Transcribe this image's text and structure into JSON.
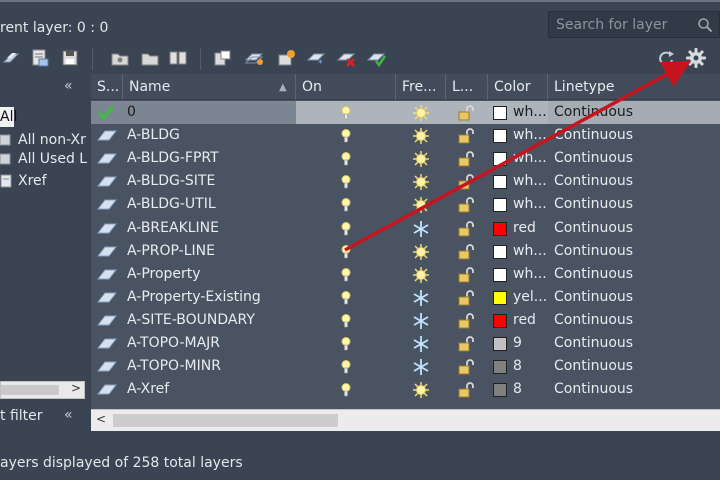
{
  "header": {
    "current_layer": "rent layer: 0 : 0"
  },
  "search": {
    "placeholder": "Search for layer"
  },
  "left_panel": {
    "collapse_glyph": "«",
    "items": [
      {
        "label": "All"
      },
      {
        "label": "All non-Xr"
      },
      {
        "label": "All Used L"
      },
      {
        "label": "Xref"
      }
    ],
    "filter_label": "t filter",
    "filter_collapse_glyph": "«"
  },
  "grid": {
    "columns": [
      {
        "key": "status",
        "label": "S..."
      },
      {
        "key": "name",
        "label": "Name"
      },
      {
        "key": "on",
        "label": "On"
      },
      {
        "key": "freeze",
        "label": "Fre..."
      },
      {
        "key": "lock",
        "label": "L..."
      },
      {
        "key": "color",
        "label": "Color"
      },
      {
        "key": "linetype",
        "label": "Linetype"
      }
    ],
    "rows": [
      {
        "name": "0",
        "current": true,
        "freeze": "sun",
        "color_name": "wh...",
        "color_hex": "#ffffff",
        "linetype": "Continuous"
      },
      {
        "name": "A-BLDG",
        "current": false,
        "freeze": "sun",
        "color_name": "wh...",
        "color_hex": "#ffffff",
        "linetype": "Continuous"
      },
      {
        "name": "A-BLDG-FPRT",
        "current": false,
        "freeze": "sun",
        "color_name": "wh...",
        "color_hex": "#ffffff",
        "linetype": "Continuous"
      },
      {
        "name": "A-BLDG-SITE",
        "current": false,
        "freeze": "sun",
        "color_name": "wh...",
        "color_hex": "#ffffff",
        "linetype": "Continuous"
      },
      {
        "name": "A-BLDG-UTIL",
        "current": false,
        "freeze": "sun",
        "color_name": "wh...",
        "color_hex": "#ffffff",
        "linetype": "Continuous"
      },
      {
        "name": "A-BREAKLINE",
        "current": false,
        "freeze": "snow",
        "color_name": "red",
        "color_hex": "#ff0000",
        "linetype": "Continuous"
      },
      {
        "name": "A-PROP-LINE",
        "current": false,
        "freeze": "sun",
        "color_name": "wh...",
        "color_hex": "#ffffff",
        "linetype": "Continuous"
      },
      {
        "name": "A-Property",
        "current": false,
        "freeze": "sun",
        "color_name": "wh...",
        "color_hex": "#ffffff",
        "linetype": "Continuous"
      },
      {
        "name": "A-Property-Existing",
        "current": false,
        "freeze": "snow",
        "color_name": "yel...",
        "color_hex": "#ffff00",
        "linetype": "Continuous"
      },
      {
        "name": "A-SITE-BOUNDARY",
        "current": false,
        "freeze": "snow",
        "color_name": "red",
        "color_hex": "#ff0000",
        "linetype": "Continuous"
      },
      {
        "name": "A-TOPO-MAJR",
        "current": false,
        "freeze": "snow",
        "color_name": "9",
        "color_hex": "#c0c0c0",
        "linetype": "Continuous"
      },
      {
        "name": "A-TOPO-MINR",
        "current": false,
        "freeze": "snow",
        "color_name": "8",
        "color_hex": "#808080",
        "linetype": "Continuous"
      },
      {
        "name": "A-Xref",
        "current": false,
        "freeze": "sun",
        "color_name": "8",
        "color_hex": "#808080",
        "linetype": "Continuous"
      }
    ]
  },
  "status_bar": {
    "text": "ayers displayed of 258 total layers"
  },
  "colors": {
    "panel_bg": "#3b4453",
    "grid_bg": "#4a5362",
    "annotation_arrow": "#c8141e"
  }
}
